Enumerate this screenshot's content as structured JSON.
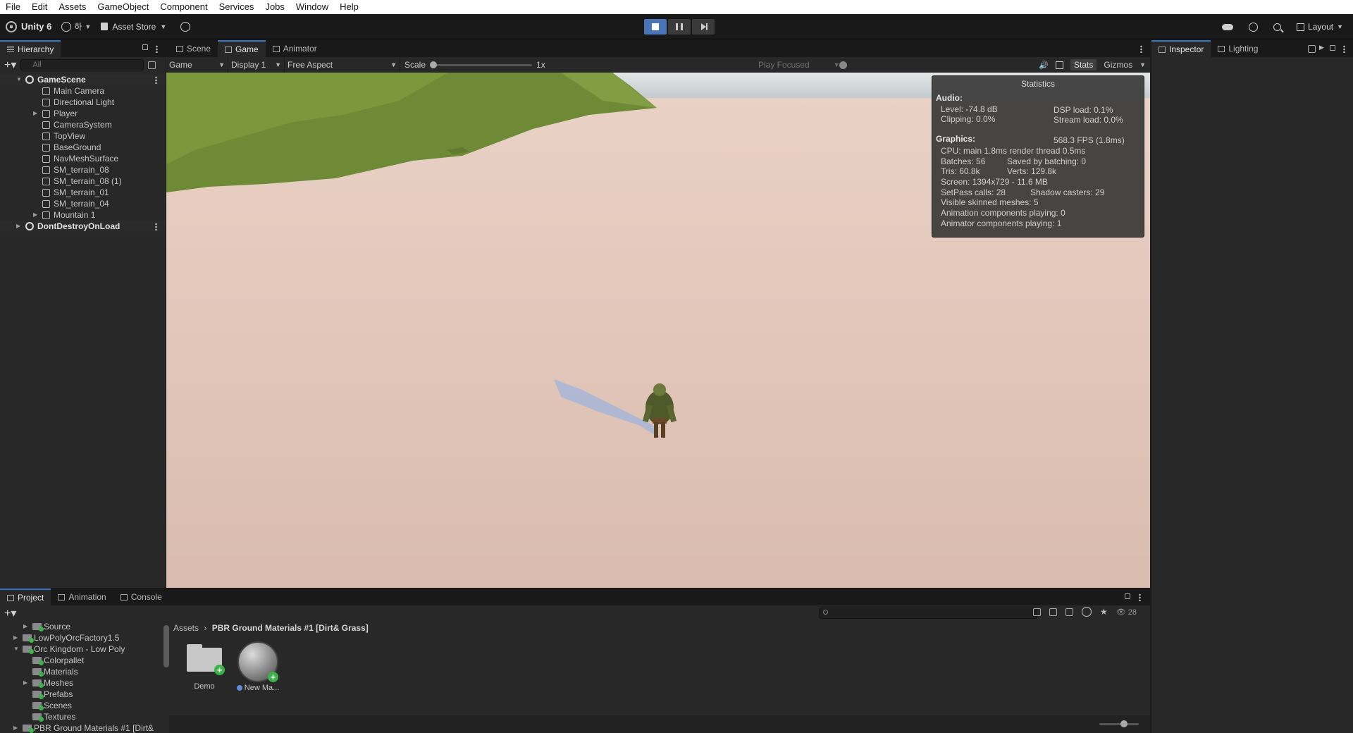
{
  "menu": [
    "File",
    "Edit",
    "Assets",
    "GameObject",
    "Component",
    "Services",
    "Jobs",
    "Window",
    "Help"
  ],
  "toolbar": {
    "unity_label": "Unity 6",
    "account_label": "하",
    "asset_store_label": "Asset Store",
    "layout_label": "Layout"
  },
  "hierarchy": {
    "tab_label": "Hierarchy",
    "search_placeholder": "All",
    "items": [
      {
        "label": "GameScene",
        "kind": "scene"
      },
      {
        "label": "Main Camera",
        "kind": "object"
      },
      {
        "label": "Directional Light",
        "kind": "object"
      },
      {
        "label": "Player",
        "kind": "object"
      },
      {
        "label": "CameraSystem",
        "kind": "object"
      },
      {
        "label": "TopView",
        "kind": "object"
      },
      {
        "label": "BaseGround",
        "kind": "object"
      },
      {
        "label": "NavMeshSurface",
        "kind": "object"
      },
      {
        "label": "SM_terrain_08",
        "kind": "object"
      },
      {
        "label": "SM_terrain_08 (1)",
        "kind": "object"
      },
      {
        "label": "SM_terrain_01",
        "kind": "object"
      },
      {
        "label": "SM_terrain_04",
        "kind": "object"
      },
      {
        "label": "Mountain 1",
        "kind": "object"
      },
      {
        "label": "DontDestroyOnLoad",
        "kind": "scene"
      }
    ]
  },
  "view_tabs": [
    "Scene",
    "Game",
    "Animator"
  ],
  "game_toolbar": {
    "mode": "Game",
    "display": "Display 1",
    "aspect": "Free Aspect",
    "scale_label": "Scale",
    "scale_value": "1x",
    "play_focused": "Play Focused",
    "stats": "Stats",
    "gizmos": "Gizmos"
  },
  "statistics": {
    "title": "Statistics",
    "audio_header": "Audio:",
    "level": "Level: -74.8 dB",
    "dsp": "DSP load: 0.1%",
    "clipping": "Clipping: 0.0%",
    "stream": "Stream load: 0.0%",
    "graphics_header": "Graphics:",
    "fps": "568.3 FPS (1.8ms)",
    "cpu": "CPU: main 1.8ms  render thread 0.5ms",
    "batches": "Batches: 56",
    "saved_batching": "Saved by batching: 0",
    "tris": "Tris: 60.8k",
    "verts": "Verts: 129.8k",
    "screen": "Screen: 1394x729 - 11.6 MB",
    "setpass": "SetPass calls: 28",
    "shadow": "Shadow casters: 29",
    "skinned": "Visible skinned meshes: 5",
    "anim_comp": "Animation components playing: 0",
    "animator_comp": "Animator components playing: 1"
  },
  "inspector_tabs": [
    "Inspector",
    "Lighting"
  ],
  "bottom_tabs": [
    "Project",
    "Animation",
    "Console"
  ],
  "project": {
    "hidden_count": "28",
    "tree": [
      {
        "label": "Source",
        "indent": 2,
        "arrow": "right"
      },
      {
        "label": "LowPolyOrcFactory1.5",
        "indent": 1,
        "arrow": "right"
      },
      {
        "label": "Orc Kingdom - Low Poly",
        "indent": 1,
        "arrow": "down"
      },
      {
        "label": "Colorpallet",
        "indent": 2,
        "arrow": ""
      },
      {
        "label": "Materials",
        "indent": 2,
        "arrow": ""
      },
      {
        "label": "Meshes",
        "indent": 2,
        "arrow": "right"
      },
      {
        "label": "Prefabs",
        "indent": 2,
        "arrow": ""
      },
      {
        "label": "Scenes",
        "indent": 2,
        "arrow": ""
      },
      {
        "label": "Textures",
        "indent": 2,
        "arrow": ""
      },
      {
        "label": "PBR Ground Materials #1 [Dirt&",
        "indent": 1,
        "arrow": "right"
      }
    ],
    "breadcrumb_root": "Assets",
    "breadcrumb_current": "PBR Ground Materials #1 [Dirt& Grass]",
    "assets": [
      {
        "label": "Demo",
        "type": "folder"
      },
      {
        "label": "New Ma...",
        "type": "material"
      }
    ]
  }
}
